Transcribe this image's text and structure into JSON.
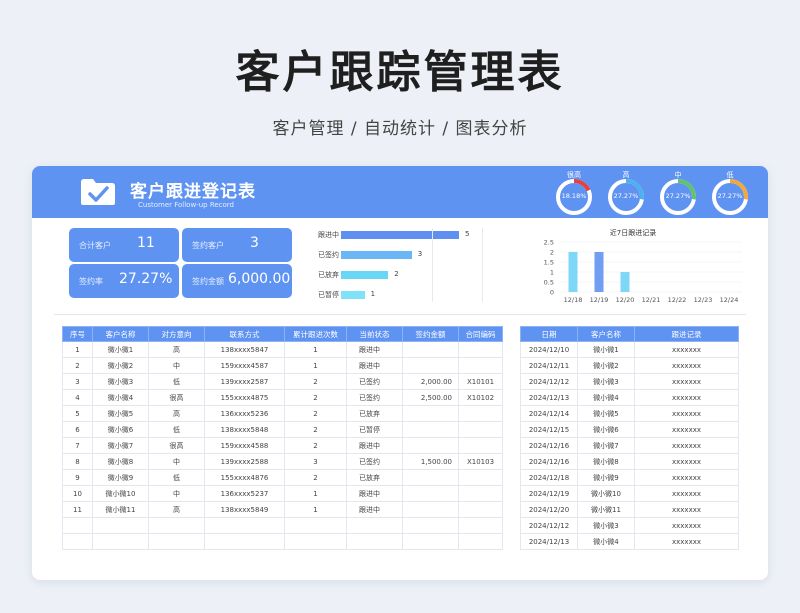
{
  "header": {
    "title": "客户跟踪管理表",
    "subtitle": "客户管理 / 自动统计 / 图表分析"
  },
  "banner": {
    "title": "客户跟进登记表",
    "subtitle": "Customer Follow-up Record",
    "gauges": [
      {
        "label": "很高",
        "value": "18.18%",
        "fraction": 0.1818,
        "color": "#e8413c"
      },
      {
        "label": "高",
        "value": "27.27%",
        "fraction": 0.2727,
        "color": "#4fb0f0"
      },
      {
        "label": "中",
        "value": "27.27%",
        "fraction": 0.2727,
        "color": "#62c46a"
      },
      {
        "label": "低",
        "value": "27.27%",
        "fraction": 0.2727,
        "color": "#f2a93b"
      }
    ]
  },
  "kpis": [
    {
      "label": "合计客户",
      "value": "11"
    },
    {
      "label": "签约客户",
      "value": "3"
    },
    {
      "label": "签约率",
      "value": "27.27%"
    },
    {
      "label": "签约金额",
      "value": "6,000.00"
    }
  ],
  "status_chart": {
    "type": "bar",
    "categories": [
      "跟进中",
      "已签约",
      "已放弃",
      "已暂停"
    ],
    "values": [
      5,
      3,
      2,
      1
    ],
    "colors": [
      "#5f8ff0",
      "#6ab6f7",
      "#6ad6f5",
      "#7ee3f6"
    ],
    "xlim": [
      0,
      5
    ]
  },
  "chart_data": {
    "type": "bar",
    "title": "近7日跟进记录",
    "categories": [
      "12/18",
      "12/19",
      "12/20",
      "12/21",
      "12/22",
      "12/23",
      "12/24"
    ],
    "values": [
      2,
      2,
      1,
      0,
      0,
      0,
      0
    ],
    "ylim": [
      0,
      2.5
    ],
    "yticks": [
      "0",
      "0.5",
      "1",
      "1.5",
      "2",
      "2.5"
    ],
    "colors": [
      "#7fd7f7",
      "#6f9ef2",
      "#7fd7f7",
      "#6f9ef2",
      "#7fd7f7",
      "#6f9ef2",
      "#7fd7f7"
    ],
    "grid": true
  },
  "main_table": {
    "columns": [
      "序号",
      "客户名称",
      "对方意向",
      "联系方式",
      "累计跟进次数",
      "当前状态",
      "签约金额",
      "合同编码"
    ],
    "rows": [
      [
        "1",
        "微小微1",
        "高",
        "138xxxx5847",
        "1",
        "跟进中",
        "",
        ""
      ],
      [
        "2",
        "微小微2",
        "中",
        "159xxxx4587",
        "1",
        "跟进中",
        "",
        ""
      ],
      [
        "3",
        "微小微3",
        "低",
        "139xxxx2587",
        "2",
        "已签约",
        "2,000.00",
        "X10101"
      ],
      [
        "4",
        "微小微4",
        "很高",
        "155xxxx4875",
        "2",
        "已签约",
        "2,500.00",
        "X10102"
      ],
      [
        "5",
        "微小微5",
        "高",
        "136xxxx5236",
        "2",
        "已放弃",
        "",
        ""
      ],
      [
        "6",
        "微小微6",
        "低",
        "138xxxx5848",
        "2",
        "已暂停",
        "",
        ""
      ],
      [
        "7",
        "微小微7",
        "很高",
        "159xxxx4588",
        "2",
        "跟进中",
        "",
        ""
      ],
      [
        "8",
        "微小微8",
        "中",
        "139xxxx2588",
        "3",
        "已签约",
        "1,500.00",
        "X10103"
      ],
      [
        "9",
        "微小微9",
        "低",
        "155xxxx4876",
        "2",
        "已放弃",
        "",
        ""
      ],
      [
        "10",
        "微小微10",
        "中",
        "136xxxx5237",
        "1",
        "跟进中",
        "",
        ""
      ],
      [
        "11",
        "微小微11",
        "高",
        "138xxxx5849",
        "1",
        "跟进中",
        "",
        ""
      ],
      [
        "",
        "",
        "",
        "",
        "",
        "",
        "",
        ""
      ],
      [
        "",
        "",
        "",
        "",
        "",
        "",
        "",
        ""
      ]
    ]
  },
  "log_table": {
    "columns": [
      "日期",
      "客户名称",
      "跟进记录"
    ],
    "rows": [
      [
        "2024/12/10",
        "微小微1",
        "xxxxxxx"
      ],
      [
        "2024/12/11",
        "微小微2",
        "xxxxxxx"
      ],
      [
        "2024/12/12",
        "微小微3",
        "xxxxxxx"
      ],
      [
        "2024/12/13",
        "微小微4",
        "xxxxxxx"
      ],
      [
        "2024/12/14",
        "微小微5",
        "xxxxxxx"
      ],
      [
        "2024/12/15",
        "微小微6",
        "xxxxxxx"
      ],
      [
        "2024/12/16",
        "微小微7",
        "xxxxxxx"
      ],
      [
        "2024/12/16",
        "微小微8",
        "xxxxxxx"
      ],
      [
        "2024/12/18",
        "微小微9",
        "xxxxxxx"
      ],
      [
        "2024/12/19",
        "微小微10",
        "xxxxxxx"
      ],
      [
        "2024/12/20",
        "微小微11",
        "xxxxxxx"
      ],
      [
        "2024/12/12",
        "微小微3",
        "xxxxxxx"
      ],
      [
        "2024/12/13",
        "微小微4",
        "xxxxxxx"
      ]
    ]
  }
}
